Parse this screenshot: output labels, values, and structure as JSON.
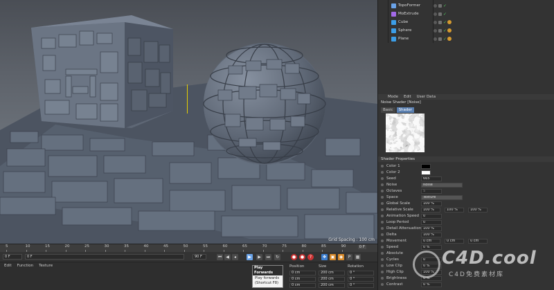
{
  "objects": [
    {
      "name": "TopoFormer",
      "icon_color": "#6aa3e8"
    },
    {
      "name": "MoExtrude",
      "icon_color": "#a36ae8"
    },
    {
      "name": "Cube",
      "icon_color": "#3c9ee8"
    },
    {
      "name": "Sphere",
      "icon_color": "#3c9ee8"
    },
    {
      "name": "Plane",
      "icon_color": "#3c9ee8"
    }
  ],
  "attr": {
    "menu": [
      "Mode",
      "Edit",
      "User Data"
    ],
    "title": "Noise Shader [Noise]",
    "tabs": [
      "Basic",
      "Shader"
    ],
    "section": "Shader Properties",
    "props": [
      {
        "label": "Color 1",
        "value": ""
      },
      {
        "label": "Color 2",
        "value": ""
      },
      {
        "label": "Seed",
        "value": "665"
      },
      {
        "label": "Noise",
        "value": "Noise"
      },
      {
        "label": "Octaves",
        "value": "5"
      },
      {
        "label": "Space",
        "value": "Texture"
      },
      {
        "label": "Global Scale",
        "value": "100 %"
      },
      {
        "label": "Relative Scale",
        "value": "100 %",
        "value2": "100 %",
        "value3": "100 %"
      },
      {
        "label": "Animation Speed",
        "value": "0"
      },
      {
        "label": "Loop Period",
        "value": "0"
      },
      {
        "label": "Detail Attenuation",
        "value": "100 %"
      },
      {
        "label": "Delta",
        "value": "100 %"
      },
      {
        "label": "Movement",
        "value": "0 cm",
        "value2": "0 cm",
        "value3": "0 cm"
      },
      {
        "label": "Speed",
        "value": "0 %"
      },
      {
        "label": "Absolute",
        "value": ""
      },
      {
        "label": "Cycles",
        "value": "0"
      },
      {
        "label": "Low Clip",
        "value": "0 %"
      },
      {
        "label": "High Clip",
        "value": "100 %"
      },
      {
        "label": "Brightness",
        "value": "0 %"
      },
      {
        "label": "Contrast",
        "value": "0 %"
      }
    ]
  },
  "viewport": {
    "grid_spacing": "Grid Spacing : 100 cm"
  },
  "timeline": {
    "ticks": [
      "5",
      "10",
      "15",
      "20",
      "25",
      "30",
      "35",
      "40",
      "45",
      "50",
      "55",
      "60",
      "65",
      "70",
      "75",
      "80",
      "85",
      "90"
    ],
    "current_frame": "0 F"
  },
  "transport": {
    "start": "0 F",
    "min": "0 F",
    "max": "90 F",
    "end": "90 F"
  },
  "bottom": {
    "menu": [
      "Edit",
      "Function",
      "Texture"
    ],
    "position": "Position",
    "size": "Size",
    "rotation": "Rotation",
    "coords": [
      {
        "p": "0 cm",
        "s": "200 cm",
        "r": "0 °"
      },
      {
        "p": "0 cm",
        "s": "200 cm",
        "r": "0 °"
      },
      {
        "p": "0 cm",
        "s": "200 cm",
        "r": "0 °"
      }
    ]
  },
  "tooltip": {
    "title": "Play Forwards",
    "line1": "Play forwards",
    "line2": "(Shortcut F8)"
  },
  "watermark": {
    "text": "C4D.cool",
    "sub": "C4D免费素材库"
  }
}
